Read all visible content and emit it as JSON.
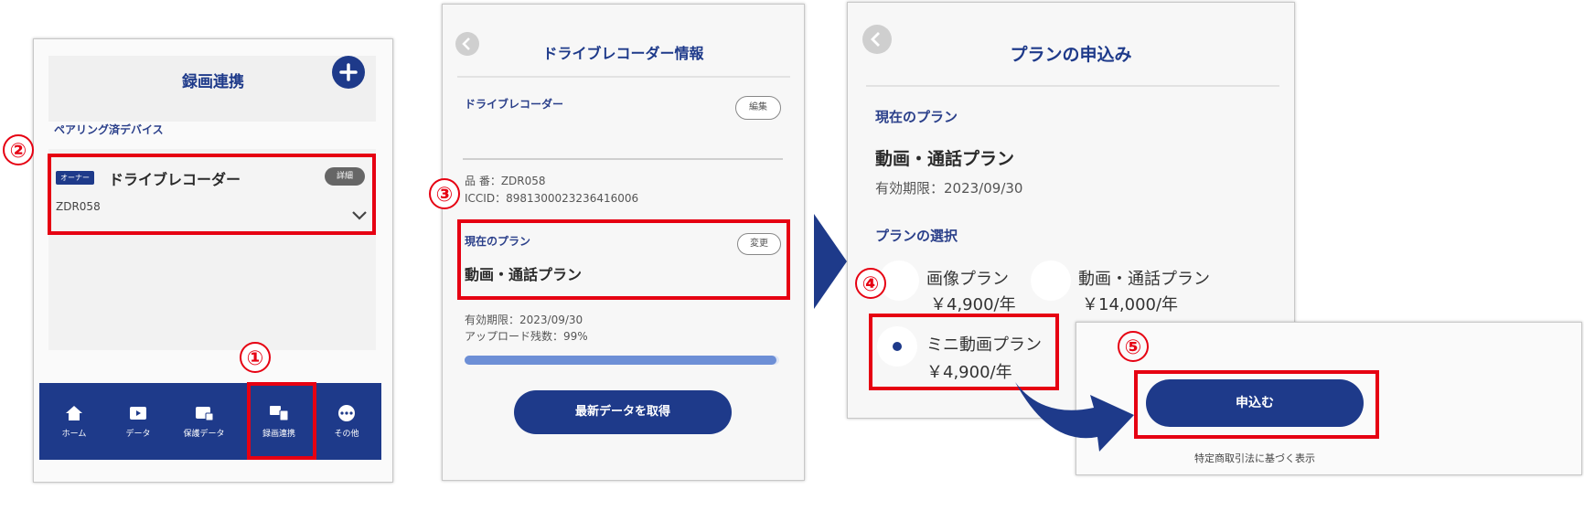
{
  "panel1": {
    "title": "録画連携",
    "section_label": "ペアリング済デバイス",
    "device": {
      "badge": "オーナー",
      "name": "ドライブレコーダー",
      "detail_label": "詳細",
      "id": "ZDR058"
    },
    "nav": [
      {
        "label": "ホーム",
        "icon": "home-icon"
      },
      {
        "label": "データ",
        "icon": "data-icon"
      },
      {
        "label": "保護データ",
        "icon": "protected-data-icon"
      },
      {
        "label": "録画連携",
        "icon": "recording-link-icon"
      },
      {
        "label": "その他",
        "icon": "more-icon"
      }
    ]
  },
  "panel2": {
    "title": "ドライブレコーダー情報",
    "section_label": "ドライブレコーダー",
    "edit_label": "編集",
    "model_line": "品 番：ZDR058",
    "iccid_line": "ICCID：8981300023236416006",
    "plan_section": "現在のプラン",
    "change_label": "変更",
    "plan_name": "動画・通話プラン",
    "expiry_line": "有効期限：2023/09/30",
    "upload_line": "アップロード残数：99%",
    "upload_percent": 99,
    "fetch_button": "最新データを取得"
  },
  "panel3": {
    "title": "プランの申込み",
    "current_section": "現在のプラン",
    "current_plan": "動画・通話プラン",
    "current_expiry": "有効期限：2023/09/30",
    "select_section": "プランの選択",
    "options": [
      {
        "name": "画像プラン",
        "price": "￥4,900/年",
        "selected": false
      },
      {
        "name": "動画・通話プラン",
        "price": "￥14,000/年",
        "selected": false
      },
      {
        "name": "ミニ動画プラン",
        "price": "￥4,900/年",
        "selected": true
      }
    ]
  },
  "panel4": {
    "apply_button": "申込む",
    "legal_text": "特定商取引法に基づく表示"
  },
  "callouts": [
    "①",
    "②",
    "③",
    "④",
    "⑤"
  ],
  "colors": {
    "brand": "#1e3a8a",
    "highlight": "#e60012",
    "progress": "#6d8fd6"
  }
}
